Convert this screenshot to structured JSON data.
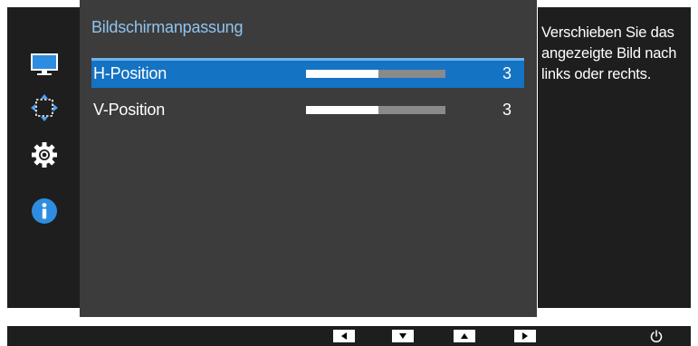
{
  "menu": {
    "title": "Bildschirmanpassung",
    "items": [
      {
        "label": "H-Position",
        "value": "3",
        "level": 0.52,
        "selected": true
      },
      {
        "label": "V-Position",
        "value": "3",
        "level": 0.52,
        "selected": false
      }
    ]
  },
  "sidebar": {
    "icons": [
      "monitor-icon",
      "move-arrows-icon",
      "settings-gear-icon",
      "info-icon"
    ],
    "active_icon": "move-arrows-icon"
  },
  "help": {
    "text": "Verschieben Sie das angezeigte Bild nach links oder rechts."
  },
  "bottom_bar": {
    "buttons": [
      "left-arrow-icon",
      "down-arrow-icon",
      "up-arrow-icon",
      "right-arrow-icon",
      "power-icon"
    ]
  },
  "colors": {
    "selection": "#1573c4",
    "title": "#8fc3f0",
    "panel": "#3c3c3c",
    "frame": "#1e1e1e",
    "accent_icon": "#4aa3ff"
  }
}
